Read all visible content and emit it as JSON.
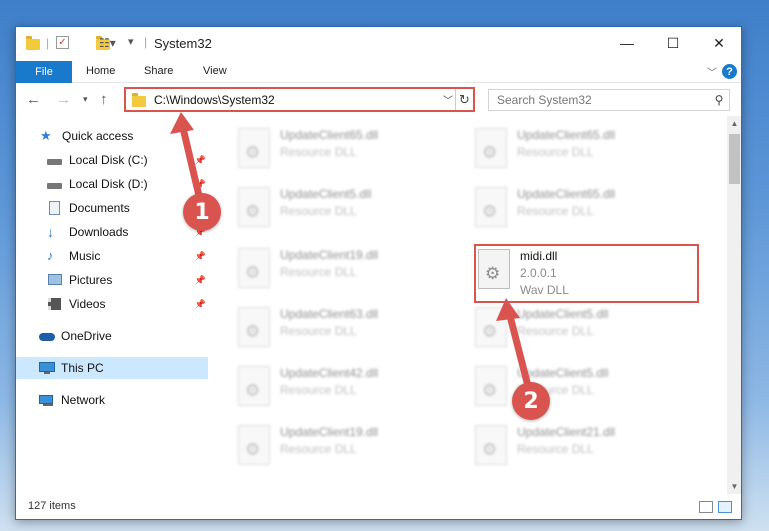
{
  "window": {
    "title": "System32",
    "controls": {
      "minimize": "—",
      "maximize": "☐",
      "close": "✕"
    }
  },
  "ribbon": {
    "tabs": [
      "File",
      "Home",
      "Share",
      "View"
    ],
    "help": "?"
  },
  "navigation": {
    "address": "C:\\Windows\\System32",
    "search_placeholder": "Search System32"
  },
  "sidebar": {
    "items": [
      {
        "label": "Quick access",
        "icon": "star-icon"
      },
      {
        "label": "Local Disk (C:)",
        "icon": "drive-icon"
      },
      {
        "label": "Local Disk (D:)",
        "icon": "drive-icon"
      },
      {
        "label": "Documents",
        "icon": "documents-icon"
      },
      {
        "label": "Downloads",
        "icon": "download-icon"
      },
      {
        "label": "Music",
        "icon": "music-icon"
      },
      {
        "label": "Pictures",
        "icon": "pictures-icon"
      },
      {
        "label": "Videos",
        "icon": "videos-icon"
      },
      {
        "label": "OneDrive",
        "icon": "cloud-icon"
      },
      {
        "label": "This PC",
        "icon": "computer-icon"
      },
      {
        "label": "Network",
        "icon": "network-icon"
      }
    ]
  },
  "files": [
    {
      "name": "UpdateClient65.dll",
      "type": "Resource DLL"
    },
    {
      "name": "UpdateClient65.dll",
      "type": "Resource DLL"
    },
    {
      "name": "UpdateClient5.dll",
      "type": "Resource DLL"
    },
    {
      "name": "UpdateClient65.dll",
      "type": "Resource DLL"
    },
    {
      "name": "UpdateClient19.dll",
      "type": "Resource DLL"
    },
    {
      "name": "midi.dll",
      "version": "2.0.0.1",
      "type": "Wav DLL"
    },
    {
      "name": "UpdateClient63.dll",
      "type": "Resource DLL"
    },
    {
      "name": "UpdateClient5.dll",
      "type": "Resource DLL"
    },
    {
      "name": "UpdateClient42.dll",
      "type": "Resource DLL"
    },
    {
      "name": "UpdateClient5.dll",
      "type": "Resource DLL"
    },
    {
      "name": "UpdateClient19.dll",
      "type": "Resource DLL"
    },
    {
      "name": "UpdateClient21.dll",
      "type": "Resource DLL"
    }
  ],
  "status": {
    "item_count": "127 items"
  },
  "annotations": {
    "step1": "1",
    "step2": "2",
    "color": "#d9534f"
  }
}
